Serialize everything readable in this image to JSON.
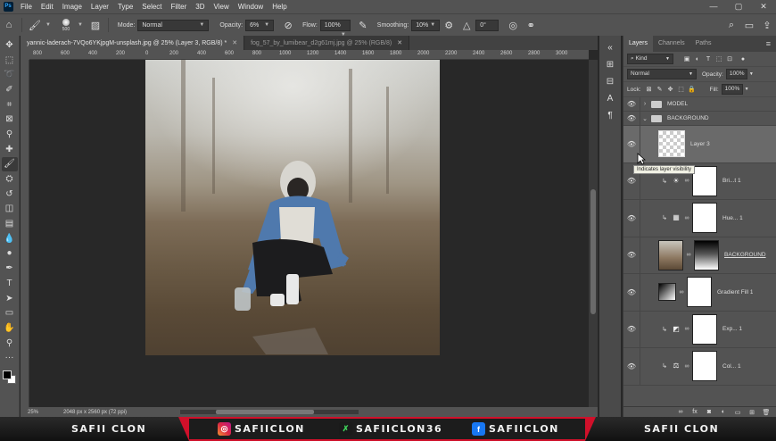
{
  "menubar": {
    "app_logo": "Ps",
    "items": [
      "File",
      "Edit",
      "Image",
      "Layer",
      "Type",
      "Select",
      "Filter",
      "3D",
      "View",
      "Window",
      "Help"
    ]
  },
  "options": {
    "brush_size": "500",
    "mode_label": "Mode:",
    "mode_value": "Normal",
    "opacity_label": "Opacity:",
    "opacity_value": "6%",
    "flow_label": "Flow:",
    "flow_value": "100%",
    "smoothing_label": "Smoothing:",
    "smoothing_value": "10%",
    "angle_value": "0°"
  },
  "tabs": [
    {
      "label": "yannic-laderach-7VQo6YKjpgM-unsplash.jpg @ 25% (Layer 3, RGB/8) *"
    },
    {
      "label": "fog_57_by_lumibear_d2g61mj.jpg @ 25% (RGB/8)"
    }
  ],
  "ruler": [
    "800",
    "600",
    "400",
    "200",
    "0",
    "200",
    "400",
    "600",
    "800",
    "1000",
    "1200",
    "1400",
    "1600",
    "1800",
    "2000",
    "2200",
    "2400",
    "2600",
    "2800",
    "3000"
  ],
  "status": {
    "zoom": "25%",
    "doc_info": "2048 px x 2560 px (72 ppi)"
  },
  "panel": {
    "tabs": [
      "Layers",
      "Channels",
      "Paths"
    ],
    "kind_value": "Kind",
    "blend_value": "Normal",
    "opacity_label": "Opacity:",
    "opacity_value": "100%",
    "lock_label": "Lock:",
    "fill_label": "Fill:",
    "fill_value": "100%"
  },
  "layers": [
    {
      "name": "MODEL"
    },
    {
      "name": "BACKGROUND"
    },
    {
      "name": "Layer 3"
    },
    {
      "name": "Bri...t 1"
    },
    {
      "name": "Hue... 1"
    },
    {
      "name": "BACKGROUND"
    },
    {
      "name": "Gradient Fill 1"
    },
    {
      "name": "Exp... 1"
    },
    {
      "name": "Col... 1"
    }
  ],
  "tooltip": "Indicates layer visibility",
  "banner": {
    "left": "SAFII CLON",
    "instagram": "SAFIICLON",
    "app": "SAFIICLON36",
    "facebook": "SAFIICLON",
    "right": "SAFII CLON"
  }
}
